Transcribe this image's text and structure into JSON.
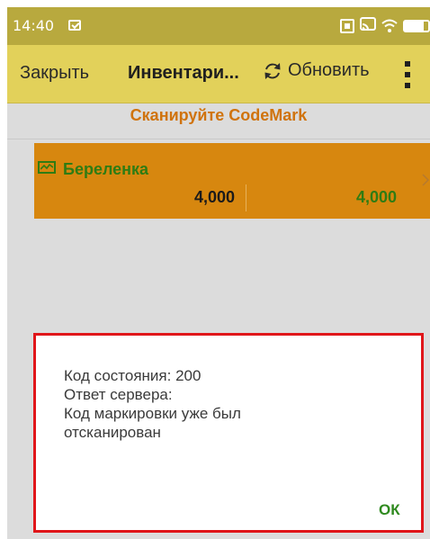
{
  "status_bar": {
    "time": "14:40",
    "icons": [
      "notification-icon",
      "screenshot-icon",
      "cast-icon",
      "wifi-icon",
      "battery-icon"
    ]
  },
  "toolbar": {
    "close_label": "Закрыть",
    "title": "Инвентари...",
    "refresh_label": "Обновить",
    "more_icon": "overflow-menu-icon"
  },
  "scan_prompt": "Сканируйте CodeMark",
  "list": {
    "items": [
      {
        "icon": "product-icon",
        "name": "Береленка",
        "qty_expected": "4,000",
        "qty_counted": "4,000"
      }
    ]
  },
  "dialog": {
    "line1": "Код состояния: 200",
    "line2": "Ответ сервера:",
    "line3": "Код маркировки уже был",
    "line4": "отсканирован",
    "ok_label": "ОК"
  },
  "colors": {
    "status_bar": "#b8a93e",
    "toolbar": "#e2d15a",
    "list_item": "#d7870f",
    "accent_green": "#2f7c13",
    "prompt_orange": "#d0730d",
    "highlight_red": "#e0161a"
  }
}
